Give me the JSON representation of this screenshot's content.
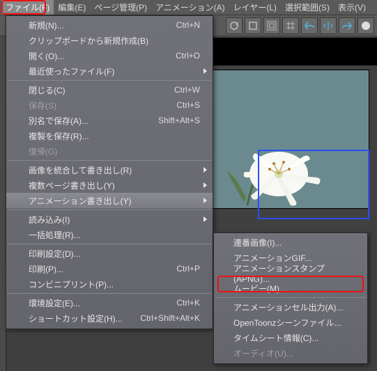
{
  "menubar": {
    "file": "ファイル(F)",
    "edit": "編集(E)",
    "page": "ページ管理(P)",
    "animation": "アニメーション(A)",
    "layer": "レイヤー(L)",
    "select": "選択範囲(S)",
    "view": "表示(V)"
  },
  "file_menu": [
    {
      "label": "新規(N)...",
      "shortcut": "Ctrl+N"
    },
    {
      "label": "クリップボードから新規作成(B)"
    },
    {
      "label": "開く(O)...",
      "shortcut": "Ctrl+O"
    },
    {
      "label": "最近使ったファイル(F)",
      "arrow": true
    },
    {
      "sep": true
    },
    {
      "label": "閉じる(C)",
      "shortcut": "Ctrl+W"
    },
    {
      "label": "保存(S)",
      "shortcut": "Ctrl+S",
      "disabled": true
    },
    {
      "label": "別名で保存(A)...",
      "shortcut": "Shift+Alt+S"
    },
    {
      "label": "複製を保存(R)..."
    },
    {
      "label": "復帰(G)",
      "disabled": true
    },
    {
      "sep": true
    },
    {
      "label": "画像を統合して書き出し(R)",
      "arrow": true
    },
    {
      "label": "複数ページ書き出し(Y)",
      "arrow": true
    },
    {
      "label": "アニメーション書き出し(Y)",
      "arrow": true,
      "highlight": true
    },
    {
      "sep": true
    },
    {
      "label": "読み込み(I)",
      "arrow": true
    },
    {
      "label": "一括処理(R)..."
    },
    {
      "sep": true
    },
    {
      "label": "印刷設定(D)..."
    },
    {
      "label": "印刷(P)...",
      "shortcut": "Ctrl+P"
    },
    {
      "label": "コンビニプリント(P)..."
    },
    {
      "sep": true
    },
    {
      "label": "環境設定(E)...",
      "shortcut": "Ctrl+K"
    },
    {
      "label": "ショートカット設定(H)...",
      "shortcut": "Ctrl+Shift+Alt+K"
    }
  ],
  "submenu": [
    {
      "label": "連番画像(I)..."
    },
    {
      "label": "アニメーションGIF..."
    },
    {
      "label": "アニメーションスタンプ(APNG)..."
    },
    {
      "label": "ムービー(M)..."
    },
    {
      "sep": true
    },
    {
      "label": "アニメーションセル出力(A)..."
    },
    {
      "label": "OpenToonzシーンファイル..."
    },
    {
      "label": "タイムシート情報(C)..."
    },
    {
      "label": "オーディオ(U)...",
      "disabled": true
    }
  ]
}
